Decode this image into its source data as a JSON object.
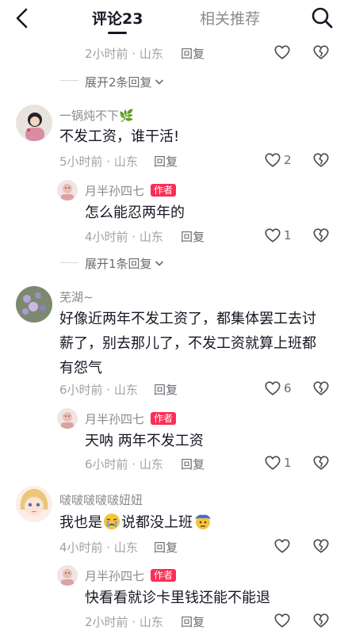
{
  "header": {
    "tab_comments": "评论23",
    "tab_related": "相关推荐"
  },
  "comments": [
    {
      "meta": "2小时前 · 山东",
      "reply": "回复",
      "expand": "展开2条回复"
    },
    {
      "user": "一锅炖不下🌿",
      "text": "不发工资，谁干活!",
      "meta": "5小时前 · 山东",
      "reply": "回复",
      "likes": "2",
      "sub": {
        "user": "月半孙四七",
        "badge": "作者",
        "text": "怎么能忍两年的",
        "meta": "4小时前 · 山东",
        "reply": "回复",
        "likes": "1"
      },
      "expand": "展开1条回复"
    },
    {
      "user": "芜湖~",
      "text_line1": "好像近两年不发工资了，都集体罢工去讨",
      "text_line2": "薪了，别去那儿了，不发工资就算上班都",
      "text_line3": "有怨气",
      "meta": "6小时前 · 山东",
      "reply": "回复",
      "likes": "6",
      "sub": {
        "user": "月半孙四七",
        "badge": "作者",
        "text": "天呐  两年不发工资",
        "meta": "6小时前 · 山东",
        "reply": "回复",
        "likes": "1"
      }
    },
    {
      "user": "啵啵啵啵啵妞妞",
      "text_a": "我也是",
      "text_b": "说都没上班",
      "meta": "4小时前 · 山东",
      "reply": "回复",
      "sub": {
        "user": "月半孙四七",
        "badge": "作者",
        "text": "快看看就诊卡里钱还能不能退",
        "meta": "2小时前 · 山东",
        "reply": "回复"
      }
    }
  ],
  "icons": {
    "back": "back-arrow-icon",
    "search": "search-icon",
    "like": "heart-icon",
    "dislike": "broken-heart-icon",
    "expand": "chevron-down-icon"
  },
  "colors": {
    "text": "#161823",
    "meta": "#a1a2a7",
    "badge": "#fe2c55"
  }
}
